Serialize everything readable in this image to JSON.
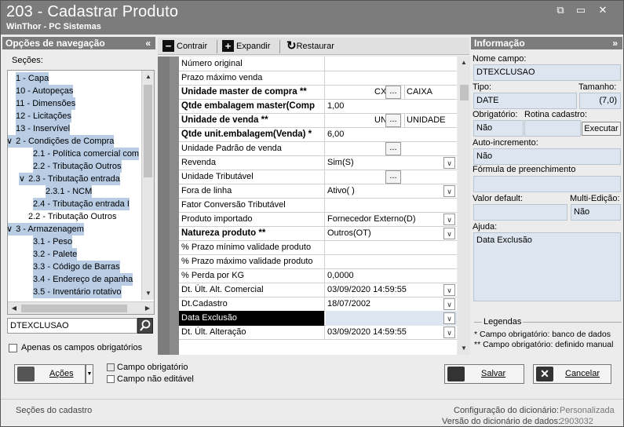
{
  "window": {
    "title": "203 - Cadastrar  Produto",
    "subtitle": "WinThor - PC Sistemas",
    "controls": {
      "restore": "⧉",
      "minimize": "▭",
      "close": "✕"
    }
  },
  "nav": {
    "header": "Opções de navegação",
    "collapse": "«",
    "sections_label": "Seções:",
    "tree": [
      {
        "label": "1 - Capa",
        "indent": 0,
        "expander": "",
        "selected": true
      },
      {
        "label": "10 - Autopeças",
        "indent": 0,
        "expander": "",
        "selected": true
      },
      {
        "label": "11 - Dimensões",
        "indent": 0,
        "expander": "",
        "selected": true
      },
      {
        "label": "12 - Licitações",
        "indent": 0,
        "expander": "",
        "selected": true
      },
      {
        "label": "13 - Inservível",
        "indent": 0,
        "expander": "",
        "selected": true
      },
      {
        "label": "2 - Condições de Compra",
        "indent": 0,
        "expander": "∨",
        "selected": true
      },
      {
        "label": "2.1 - Política comercial com",
        "indent": 2,
        "expander": "",
        "selected": true
      },
      {
        "label": "2.2 - Tributação Outros",
        "indent": 2,
        "expander": "",
        "selected": true
      },
      {
        "label": "2.3 - Tributação entrada",
        "indent": 1,
        "expander": "∨",
        "selected": true
      },
      {
        "label": "2.3.1 - NCM",
        "indent": 3,
        "expander": "",
        "selected": true
      },
      {
        "label": "2.4 - Tributação entrada I",
        "indent": 2,
        "expander": "",
        "selected": true
      },
      {
        "label": "2.2 - Tributação Outros",
        "indent": 1,
        "expander": "",
        "selected": false
      },
      {
        "label": "3 - Armazenagem",
        "indent": 0,
        "expander": "∨",
        "selected": true
      },
      {
        "label": "3.1 - Peso",
        "indent": 2,
        "expander": "",
        "selected": true
      },
      {
        "label": "3.2 - Palete",
        "indent": 2,
        "expander": "",
        "selected": true
      },
      {
        "label": "3.3 - Código de Barras",
        "indent": 2,
        "expander": "",
        "selected": true
      },
      {
        "label": "3.4 - Endereço de apanha",
        "indent": 2,
        "expander": "",
        "selected": true
      },
      {
        "label": "3.5 - Inventário rotativo",
        "indent": 2,
        "expander": "",
        "selected": true
      }
    ],
    "search_value": "DTEXCLUSAO",
    "only_required_label": "Apenas os campos obrigatórios"
  },
  "toolbar": {
    "collapse_label": "Contrair",
    "expand_label": "Expandir",
    "restore_label": "Restaurar"
  },
  "grid": {
    "rows": [
      {
        "label": "Número original",
        "bold": false,
        "value": "",
        "kind": "text"
      },
      {
        "label": "Prazo máximo venda",
        "bold": false,
        "value": "",
        "kind": "text"
      },
      {
        "label": "Unidade master de compra **",
        "bold": true,
        "code": "CX",
        "button": "...",
        "desc": "CAIXA",
        "kind": "lookup"
      },
      {
        "label": "Qtde embalagem master(Comp",
        "bold": true,
        "value": "1,00",
        "kind": "text"
      },
      {
        "label": "Unidade de venda **",
        "bold": true,
        "code": "UN",
        "button": "...",
        "desc": "UNIDADE",
        "kind": "lookup"
      },
      {
        "label": "Qtde unit.embalagem(Venda) *",
        "bold": true,
        "value": "6,00",
        "kind": "text"
      },
      {
        "label": "Unidade Padrão de venda",
        "bold": false,
        "code": "",
        "button": "...",
        "desc": "",
        "kind": "lookup"
      },
      {
        "label": "Revenda",
        "bold": false,
        "value": "Sim(S)",
        "kind": "dropdown"
      },
      {
        "label": "Unidade Tributável",
        "bold": false,
        "code": "",
        "button": "...",
        "desc": "",
        "kind": "lookup"
      },
      {
        "label": "Fora de linha",
        "bold": false,
        "value": "Ativo( )",
        "kind": "dropdown"
      },
      {
        "label": "Fator Conversão Tributável",
        "bold": false,
        "value": "",
        "kind": "text"
      },
      {
        "label": "Produto importado",
        "bold": false,
        "value": "Fornecedor Externo(D)",
        "kind": "dropdown"
      },
      {
        "label": "Natureza produto **",
        "bold": true,
        "value": "Outros(OT)",
        "kind": "dropdown"
      },
      {
        "label": "% Prazo mínimo validade produto",
        "bold": false,
        "value": "",
        "kind": "text"
      },
      {
        "label": "% Prazo máximo validade produto",
        "bold": false,
        "value": "",
        "kind": "text"
      },
      {
        "label": "% Perda por KG",
        "bold": false,
        "value": "0,0000",
        "kind": "text"
      },
      {
        "label": "Dt. Últ. Alt. Comercial",
        "bold": false,
        "value": "03/09/2020 14:59:55",
        "kind": "dropdown"
      },
      {
        "label": "Dt.Cadastro",
        "bold": false,
        "value": "18/07/2002",
        "kind": "dropdown"
      },
      {
        "label": "Data Exclusão",
        "bold": false,
        "value": "",
        "kind": "dropdown",
        "selected": true
      },
      {
        "label": "Dt. Últ. Alteração",
        "bold": false,
        "value": "03/09/2020 14:59:55",
        "kind": "dropdown"
      }
    ]
  },
  "info": {
    "header": "Informação",
    "expand": "»",
    "field_name_label": "Nome campo:",
    "field_name": "DTEXCLUSAO",
    "type_label": "Tipo:",
    "type": "DATE",
    "size_label": "Tamanho:",
    "size": "(7,0)",
    "required_label": "Obrigatório:",
    "required": "Não",
    "routine_label": "Rotina cadastro:",
    "execute_label": "Executar",
    "autoinc_label": "Auto-incremento:",
    "autoinc": "Não",
    "formula_label": "Fórmula de preenchimento",
    "formula": "",
    "default_label": "Valor default:",
    "default": "",
    "multiedit_label": "Multi-Edição:",
    "multiedit": "Não",
    "help_label": "Ajuda:",
    "help": "Data Exclusão",
    "legend_title": "Legendas",
    "legend_1": "* Campo obrigatório: banco de dados",
    "legend_2": "** Campo obrigatório: definido manual"
  },
  "footer": {
    "actions_label": "Ações",
    "required_field_label": "Campo obrigatório",
    "not_editable_label": "Campo não editável",
    "save_label": "Salvar",
    "cancel_label": "Cancelar"
  },
  "status": {
    "sections_label": "Seções do cadastro",
    "dict_config_label": "Configuração do dicionário:",
    "dict_config": "Personalizada",
    "dict_version_label": "Versão do dicionário de dados:",
    "dict_version": "2903032"
  },
  "colors": {
    "titlebar": "#7c7c7c",
    "selection": "#b8cce4",
    "field_bg": "#dde6f0"
  }
}
